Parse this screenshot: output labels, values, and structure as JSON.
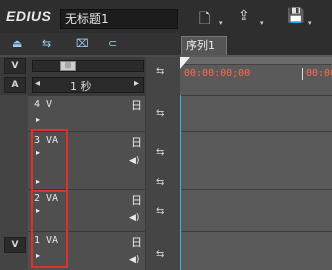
{
  "app": {
    "logo": "EDIUS",
    "project_name": "无标题1"
  },
  "toolbar": {
    "new_icon": "🗋",
    "import_icon": "⇪",
    "save_icon": "💾",
    "dropdown_arrow": "▾",
    "mode_icons": [
      "⏏",
      "⇆",
      "⌧",
      "⊂"
    ]
  },
  "track_panel": {
    "v_lock_label": "V",
    "a_lock_label": "A",
    "zoom_thumb_label": "|||",
    "scale_left_arrow": "◂",
    "scale_value": "1 秒",
    "scale_right_arrow": "▸"
  },
  "sequence": {
    "tab_label": "序列1",
    "timecode_start": "00:00:00;00",
    "timecode_next": "00:00"
  },
  "tracks": [
    {
      "label": "4 V",
      "arrow": "▸",
      "video_icon": "日",
      "audio_icon": ""
    },
    {
      "label": "3 VA",
      "arrow": "▸",
      "video_icon": "日",
      "audio_icon": "◀)"
    },
    {
      "label": "2 VA",
      "arrow": "▸",
      "video_icon": "日",
      "audio_icon": "◀)"
    },
    {
      "label": "1 VA",
      "arrow": "▸",
      "video_icon": "日",
      "audio_icon": "◀)"
    }
  ],
  "sync_icon": "⇆",
  "colors": {
    "highlight_red": "#e0302a",
    "timecode": "#ff6a4a"
  }
}
